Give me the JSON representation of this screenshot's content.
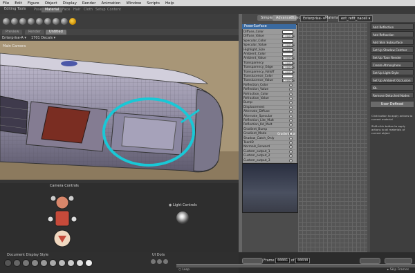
{
  "menubar": {
    "items": [
      "File",
      "Edit",
      "Figure",
      "Object",
      "Display",
      "Render",
      "Animation",
      "Window",
      "Scripts",
      "Help"
    ]
  },
  "rooms": {
    "items": [
      "Pose",
      "Material",
      "Face",
      "Hair",
      "Cloth",
      "Setup",
      "Content"
    ],
    "active": "Material"
  },
  "editing_tools_label": "Editing Tools",
  "viewport": {
    "tabs": [
      "Preview",
      "Render",
      "Untitled"
    ],
    "figure_select": "Enterprise-A",
    "actor_select": "1701 Decals",
    "camera_label": "Main Camera"
  },
  "material_editor": {
    "tabs": [
      "Simple",
      "Advanced"
    ],
    "object_label": "Object",
    "object_value": "Enterprise-",
    "material_label": "Material",
    "material_value": "ent_refit_nacell",
    "node_title": "PoserSurface",
    "properties": [
      {
        "label": "Diffuse_Color",
        "kind": "color",
        "value": ""
      },
      {
        "label": "Diffuse_Value",
        "kind": "value",
        "value": "1.000000"
      },
      {
        "label": "Specular_Color",
        "kind": "color",
        "value": ""
      },
      {
        "label": "Specular_Value",
        "kind": "value",
        "value": "1.000000"
      },
      {
        "label": "Highlight_Size",
        "kind": "value",
        "value": "0.010000"
      },
      {
        "label": "Ambient_Color",
        "kind": "color",
        "value": ""
      },
      {
        "label": "Ambient_Value",
        "kind": "value",
        "value": "0.000000"
      },
      {
        "label": "Transparency",
        "kind": "value",
        "value": "0.000000"
      },
      {
        "label": "Transparency_Edge",
        "kind": "value",
        "value": "0.000000"
      },
      {
        "label": "Transparency_Falloff",
        "kind": "value",
        "value": "0.600000"
      },
      {
        "label": "Translucence_Color",
        "kind": "color",
        "value": ""
      },
      {
        "label": "Translucence_Value",
        "kind": "value",
        "value": "0.000000"
      },
      {
        "label": "Reflection_Color",
        "kind": "dot",
        "value": ""
      },
      {
        "label": "Reflection_Value",
        "kind": "dot",
        "value": ""
      },
      {
        "label": "Refraction_Color",
        "kind": "dot",
        "value": ""
      },
      {
        "label": "Refraction_Value",
        "kind": "dot",
        "value": ""
      },
      {
        "label": "Bump",
        "kind": "dot",
        "value": ""
      },
      {
        "label": "Displacement",
        "kind": "dot",
        "value": ""
      },
      {
        "label": "Alternate_Diffuse",
        "kind": "dot",
        "value": ""
      },
      {
        "label": "Alternate_Specular",
        "kind": "dot",
        "value": ""
      },
      {
        "label": "Reflection_Lite_Mult",
        "kind": "dot",
        "value": ""
      },
      {
        "label": "Reflection_Kd_Mult",
        "kind": "dot",
        "value": ""
      },
      {
        "label": "Gradient_Bump",
        "kind": "dot",
        "value": ""
      },
      {
        "label": "Gradient_Mode",
        "kind": "dot",
        "value": "Gradient Bump"
      },
      {
        "label": "Shadow_Catch_Only",
        "kind": "dot",
        "value": ""
      },
      {
        "label": "ToonID",
        "kind": "dot",
        "value": ""
      },
      {
        "label": "Normals_Forward",
        "kind": "dot",
        "value": ""
      },
      {
        "label": "Custom_output_1",
        "kind": "dot",
        "value": ""
      },
      {
        "label": "Custom_output_2",
        "kind": "dot",
        "value": ""
      },
      {
        "label": "Custom_output_3",
        "kind": "dot",
        "value": ""
      }
    ]
  },
  "wizards": {
    "buttons": [
      "Add Reflection",
      "Add Refraction",
      "Add Skin Subsurface Scattering",
      "Set Up Shadow Catcher",
      "Set Up Toon Render",
      "Create Atmosphere",
      "Set Up Light Style",
      "Set Up Ambient Occlusion",
      "IBL",
      "Remove Detached Nodes"
    ],
    "user_defined": "User Defined",
    "note1": "Click button to apply actions to current material",
    "note2": "Shift-click button to apply actions to all materials of current object"
  },
  "panels": {
    "camera_controls": "Camera Controls",
    "light_controls": "Light Controls",
    "document_display_style": "Document Display Style",
    "ui_dots": "UI Dots"
  },
  "timeline": {
    "frame_label": "Frame",
    "frame_value": "00001",
    "of_label": "of",
    "total_value": "00030",
    "loop_label": "Loop",
    "skip_frames_label": "Skip Frames"
  },
  "colors": {
    "accent_blue": "#3a6aa0",
    "annotation_cyan": "#19c8d6"
  }
}
